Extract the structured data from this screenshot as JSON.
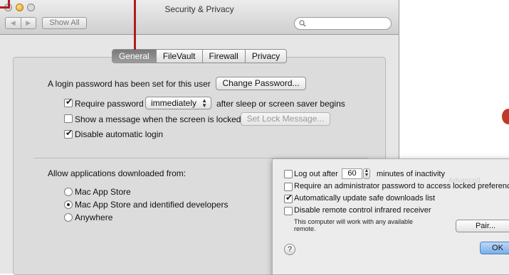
{
  "window": {
    "title": "Security & Privacy",
    "show_all": "Show All",
    "nav_back": "◀",
    "nav_forward": "▶"
  },
  "tabs": [
    "General",
    "FileVault",
    "Firewall",
    "Privacy"
  ],
  "general": {
    "login_password_text": "A login password has been set for this user",
    "change_password_label": "Change Password...",
    "require_password_label": "Require password",
    "require_password_checked": true,
    "require_password_timing": "immediately",
    "after_sleep_text": "after sleep or screen saver begins",
    "show_message_label": "Show a message when the screen is locked",
    "show_message_checked": false,
    "set_lock_message_label": "Set Lock Message...",
    "disable_auto_login_label": "Disable automatic login",
    "disable_auto_login_checked": true,
    "allow_apps_label": "Allow applications downloaded from:",
    "app_sources": [
      {
        "label": "Mac App Store",
        "selected": false
      },
      {
        "label": "Mac App Store and identified developers",
        "selected": true
      },
      {
        "label": "Anywhere",
        "selected": false
      }
    ]
  },
  "advanced_sheet": {
    "log_out_label": "Log out after",
    "log_out_checked": false,
    "log_out_minutes": "60",
    "minutes_label": "minutes of inactivity",
    "require_admin_label": "Require an administrator password to access locked preferences",
    "require_admin_checked": false,
    "auto_update_label": "Automatically update safe downloads list",
    "auto_update_checked": true,
    "disable_remote_label": "Disable remote control infrared receiver",
    "disable_remote_checked": false,
    "remote_note_line1": "This computer will work with any available",
    "remote_note_line2": "remote.",
    "pair_label": "Pair...",
    "ok_label": "OK",
    "help_label": "?"
  },
  "colors": {
    "callout_red": "#b01c22",
    "active_tab": "#8a8a8a",
    "ok_button": "#7aaee8"
  }
}
